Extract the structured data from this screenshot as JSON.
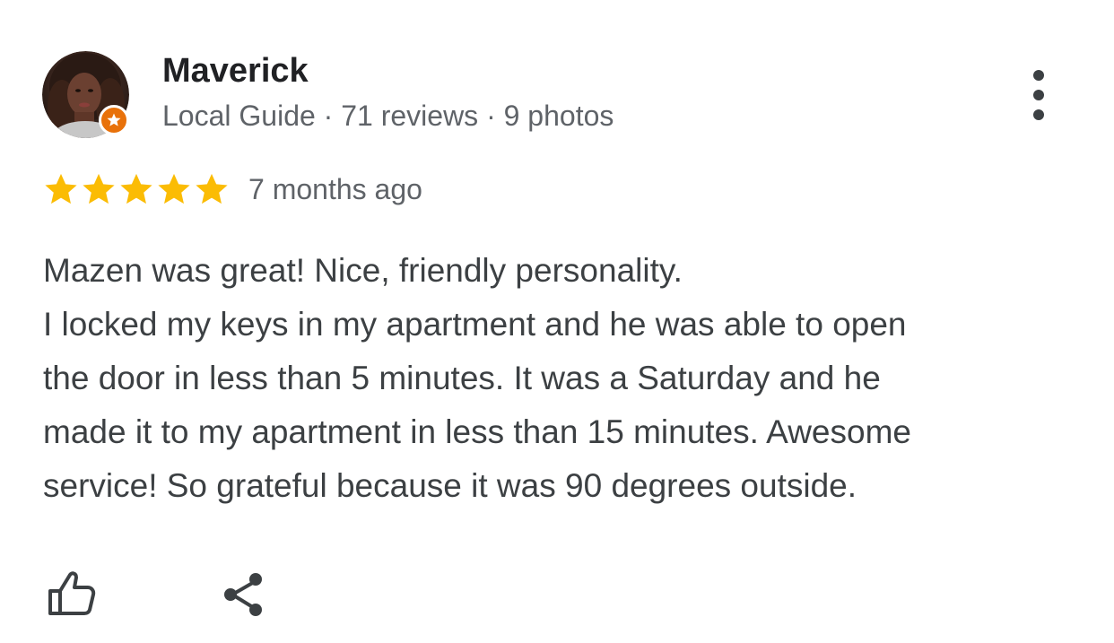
{
  "reviewer": {
    "name": "Maverick",
    "meta": "Local Guide · 71 reviews · 9 photos",
    "badge_icon": "local-guide-star-icon",
    "badge_color": "#e8710a"
  },
  "menu_icon": "more-vert-icon",
  "rating": {
    "stars": 5,
    "max": 5,
    "star_color": "#fbbc04",
    "time": "7 months ago"
  },
  "review": {
    "lines": [
      "Mazen was great! Nice, friendly personality.",
      "I locked my keys in my apartment and he was able to open",
      "the door in less than 5 minutes. It was a Saturday and he",
      "made it to my apartment in less than 15 minutes. Awesome",
      "service! So grateful because it was 90 degrees outside."
    ]
  },
  "actions": {
    "like_icon": "thumbs-up-icon",
    "share_icon": "share-icon"
  }
}
